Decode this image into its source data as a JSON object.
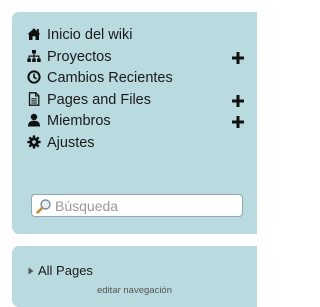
{
  "nav": {
    "items": [
      {
        "label": "Inicio del wiki",
        "icon": "home-icon",
        "has_add": false
      },
      {
        "label": "Proyectos",
        "icon": "sitemap-icon",
        "has_add": true
      },
      {
        "label": "Cambios Recientes",
        "icon": "clock-icon",
        "has_add": false
      },
      {
        "label": "Pages and Files",
        "icon": "document-icon",
        "has_add": true
      },
      {
        "label": "Miembros",
        "icon": "user-icon",
        "has_add": true
      },
      {
        "label": "Ajustes",
        "icon": "gear-icon",
        "has_add": false
      }
    ],
    "search_placeholder": "Búsqueda"
  },
  "pages": {
    "all_pages_label": "All Pages",
    "edit_nav_label": "editar navegación"
  },
  "colors": {
    "panel_bg": "#b9dadf",
    "text": "#1a1a1a",
    "plus": "#111111"
  }
}
